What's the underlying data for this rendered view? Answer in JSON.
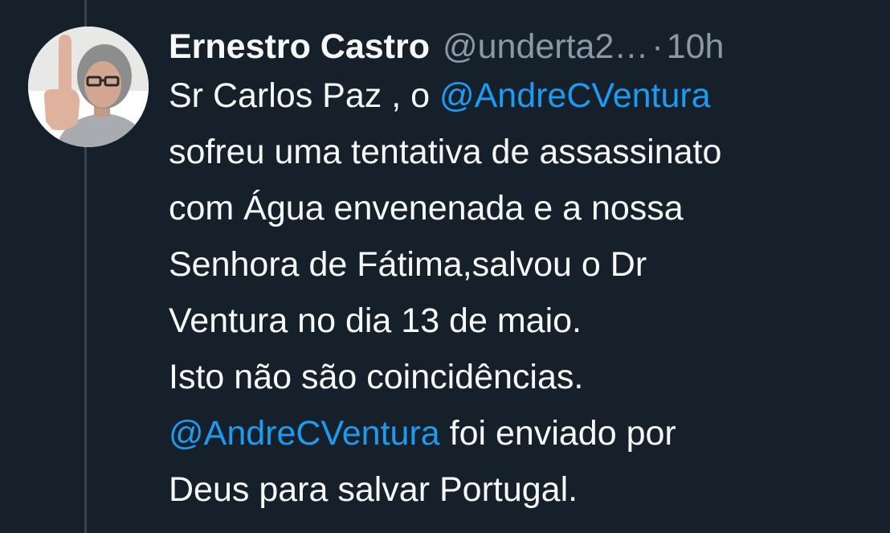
{
  "author": {
    "display_name": "Ernestro Castro",
    "handle": "@underta2…",
    "separator": "·",
    "time": "10h"
  },
  "tweet": {
    "lines": [
      [
        {
          "text": "Sr Carlos Paz , o "
        },
        {
          "text": "@AndreCVentura",
          "mention": true
        }
      ],
      [
        {
          "text": "sofreu uma tentativa de assassinato"
        }
      ],
      [
        {
          "text": "com Água envenenada e a nossa"
        }
      ],
      [
        {
          "text": "Senhora de Fátima,salvou o Dr"
        }
      ],
      [
        {
          "text": "Ventura no dia 13 de maio."
        }
      ],
      [
        {
          "text": "Isto não são coincidências."
        }
      ],
      [
        {
          "text": "@AndreCVentura",
          "mention": true
        },
        {
          "text": " foi enviado por"
        }
      ],
      [
        {
          "text": "Deus para salvar Portugal."
        }
      ]
    ]
  },
  "colors": {
    "background": "#15202b",
    "text": "#f7f9f9",
    "secondary_text": "#8b98a5",
    "mention": "#1d9bf0",
    "thread_line": "#38444d"
  }
}
